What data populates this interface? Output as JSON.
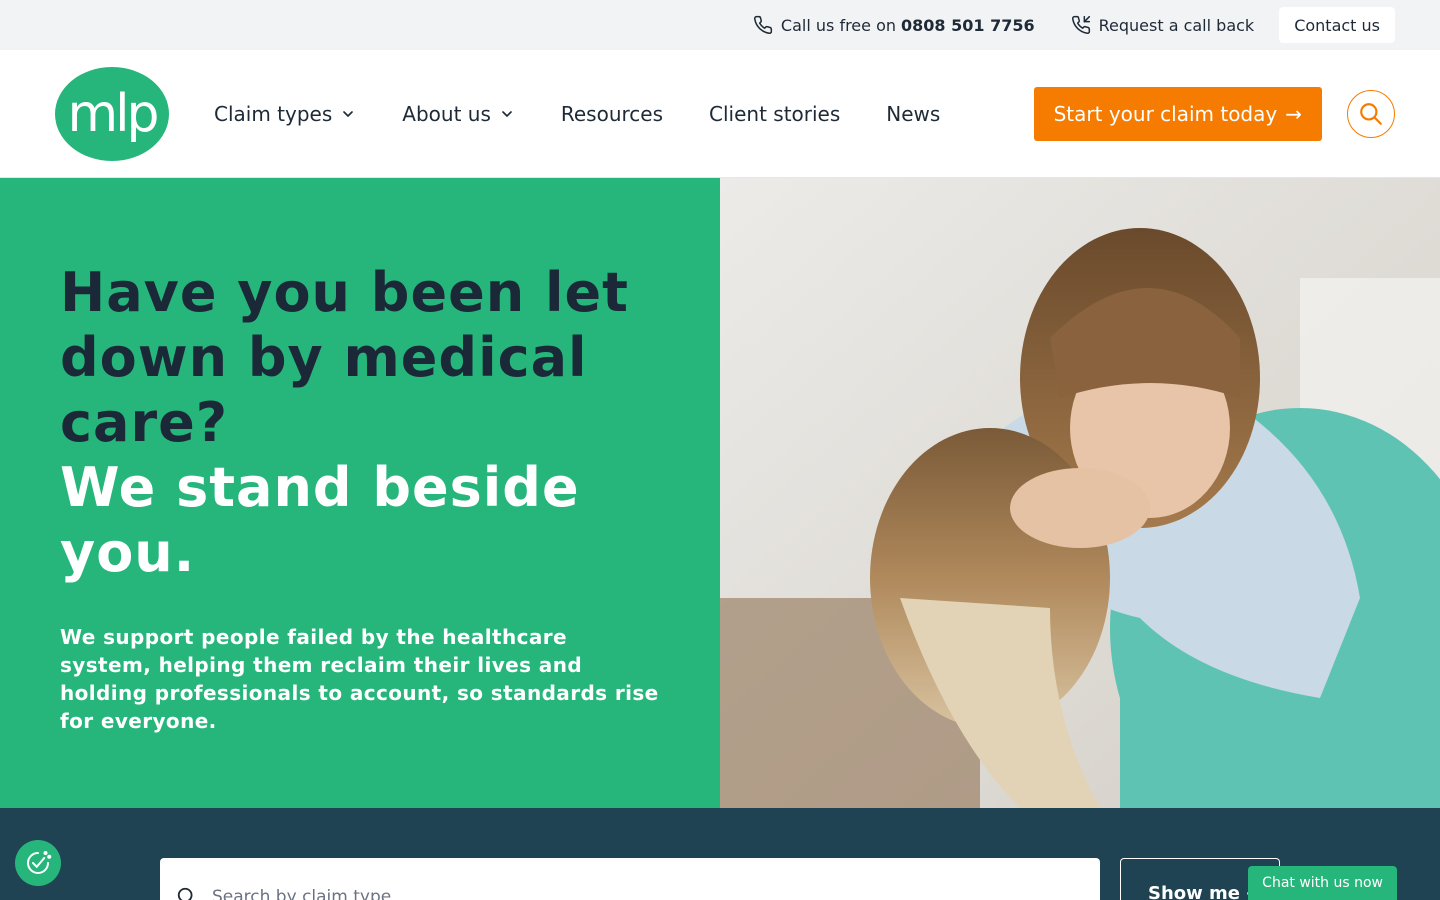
{
  "topbar": {
    "call_prefix": "Call us free on",
    "phone": "0808 501 7756",
    "callback_label": "Request a call back",
    "contact_label": "Contact us"
  },
  "header": {
    "logo_text": "mlp",
    "nav": [
      {
        "label": "Claim types",
        "dropdown": true
      },
      {
        "label": "About us",
        "dropdown": true
      },
      {
        "label": "Resources",
        "dropdown": false
      },
      {
        "label": "Client stories",
        "dropdown": false
      },
      {
        "label": "News",
        "dropdown": false
      }
    ],
    "cta_label": "Start your claim today",
    "cta_arrow": "→"
  },
  "hero": {
    "title": "Have you been let down by medical care?",
    "title2": "We stand beside you.",
    "subtitle": "We support people failed by the healthcare system, helping them reclaim their lives and holding professionals to account, so standards rise for everyone."
  },
  "search": {
    "placeholder": "Search by claim type",
    "button_label": "Show me",
    "button_arrow": "→"
  },
  "chat": {
    "label": "Chat with us now"
  },
  "colors": {
    "brand_green": "#26b67b",
    "accent_orange": "#f57c00",
    "dark_navy": "#1b2838",
    "band_teal": "#1f4352"
  }
}
